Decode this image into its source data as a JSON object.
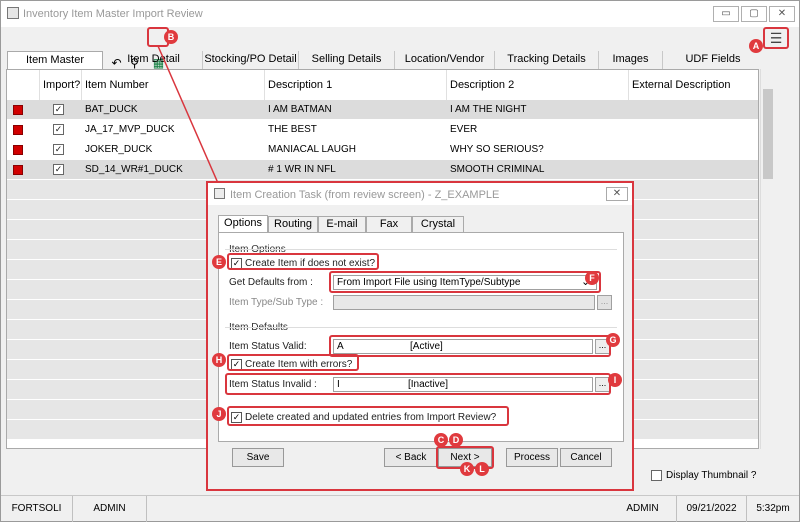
{
  "window": {
    "title": "Inventory Item Master Import Review",
    "minimize": "▭",
    "restore": "▢",
    "close": "✕"
  },
  "toolbar": [
    {
      "name": "eraser-icon",
      "glyph": "✎"
    },
    {
      "name": "save-icon",
      "glyph": "■"
    },
    {
      "name": "copy-icon",
      "glyph": "❐"
    },
    {
      "name": "list-icon",
      "glyph": "≣"
    },
    {
      "name": "delete-list-icon",
      "glyph": "☒"
    },
    {
      "name": "undo-icon",
      "glyph": "↶"
    },
    {
      "name": "find-icon",
      "glyph": "⚲"
    },
    {
      "name": "calculator-icon",
      "glyph": "▦"
    }
  ],
  "tabs": [
    "Item Master",
    "Item Detail",
    "Stocking/PO Detail",
    "Selling Details",
    "Location/Vendor",
    "Tracking Details",
    "Images",
    "UDF Fields"
  ],
  "grid": {
    "headers": [
      "Import?",
      "Item Number",
      "Description 1",
      "Description 2",
      "External Description"
    ],
    "rows": [
      {
        "item": "BAT_DUCK",
        "desc1": "I AM BATMAN",
        "desc2": "I AM THE NIGHT",
        "check": "✓"
      },
      {
        "item": "JA_17_MVP_DUCK",
        "desc1": "THE BEST",
        "desc2": "EVER",
        "check": "✓"
      },
      {
        "item": "JOKER_DUCK",
        "desc1": "MANIACAL LAUGH",
        "desc2": "WHY SO SERIOUS?",
        "check": "✓"
      },
      {
        "item": "SD_14_WR#1_DUCK",
        "desc1": "# 1 WR IN NFL",
        "desc2": "SMOOTH CRIMINAL",
        "check": "✓"
      }
    ]
  },
  "display_thumbnail": "Display Thumbnail ?",
  "status": {
    "company": "FORTSOLI",
    "user": "ADMIN",
    "user_right": "ADMIN",
    "date": "09/21/2022",
    "time": "5:32pm"
  },
  "dialog": {
    "title": "Item Creation Task (from review screen) - Z_EXAMPLE",
    "close": "✕",
    "tabs": [
      "Options",
      "Routing",
      "E-mail",
      "Fax",
      "Crystal"
    ],
    "item_options_label": "Item Options",
    "create_if_missing": "Create Item if does not exist?",
    "get_defaults_label": "Get Defaults from :",
    "get_defaults_value": "From Import File using ItemType/Subtype",
    "type_subtype_label": "Item Type/Sub Type :",
    "item_defaults_label": "Item Defaults",
    "status_valid_label": "Item Status Valid:",
    "status_valid_code": "A",
    "status_valid_desc": "[Active]",
    "create_with_errors": "Create Item with errors?",
    "status_invalid_label": "Item Status Invalid :",
    "status_invalid_code": "I",
    "status_invalid_desc": "[Inactive]",
    "delete_entries": "Delete created and updated entries from Import Review?",
    "buttons": {
      "save": "Save",
      "back": "< Back",
      "next": "Next >",
      "process": "Process",
      "cancel": "Cancel"
    },
    "ellipsis": "...",
    "check": "✓",
    "dropdown_arrow": "⌄"
  },
  "markers": [
    "A",
    "B",
    "C",
    "D",
    "E",
    "F",
    "G",
    "H",
    "I",
    "J",
    "K",
    "L"
  ],
  "colors": {
    "annotation": "#d9363e",
    "row_marker": "#d10000"
  }
}
